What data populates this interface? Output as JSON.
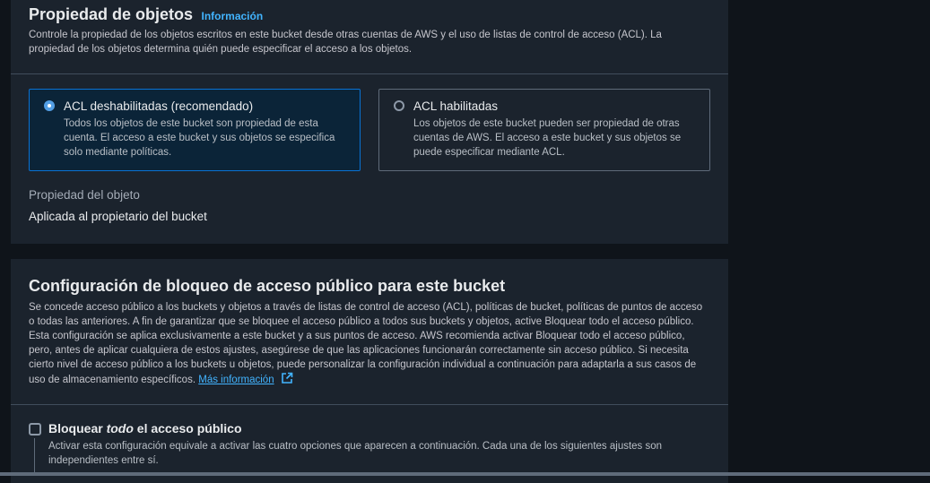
{
  "ownership": {
    "title": "Propiedad de objetos",
    "info_link": "Información",
    "description": "Controle la propiedad de los objetos escritos en este bucket desde otras cuentas de AWS y el uso de listas de control de acceso (ACL). La propiedad de los objetos determina quién puede especificar el acceso a los objetos.",
    "options": [
      {
        "label": "ACL deshabilitadas (recomendado)",
        "description": "Todos los objetos de este bucket son propiedad de esta cuenta. El acceso a este bucket y sus objetos se especifica solo mediante políticas.",
        "selected": true
      },
      {
        "label": "ACL habilitadas",
        "description": "Los objetos de este bucket pueden ser propiedad de otras cuentas de AWS. El acceso a este bucket y sus objetos se puede especificar mediante ACL.",
        "selected": false
      }
    ],
    "object_ownership_label": "Propiedad del objeto",
    "object_ownership_value": "Aplicada al propietario del bucket"
  },
  "block_public_access": {
    "title": "Configuración de bloqueo de acceso público para este bucket",
    "description": "Se concede acceso público a los buckets y objetos a través de listas de control de acceso (ACL), políticas de bucket, políticas de puntos de acceso o todas las anteriores. A fin de garantizar que se bloquee el acceso público a todos sus buckets y objetos, active Bloquear todo el acceso público. Esta configuración se aplica exclusivamente a este bucket y a sus puntos de acceso. AWS recomienda activar Bloquear todo el acceso público, pero, antes de aplicar cualquiera de estos ajustes, asegúrese de que las aplicaciones funcionarán correctamente sin acceso público. Si necesita cierto nivel de acceso público a los buckets u objetos, puede personalizar la configuración individual a continuación para adaptarla a sus casos de uso de almacenamiento específicos.",
    "more_info_link": "Más información",
    "block_all": {
      "label_prefix": "Bloquear ",
      "label_emphasis": "todo",
      "label_suffix": " el acceso público",
      "checked": false,
      "description": "Activar esta configuración equivale a activar las cuatro opciones que aparecen a continuación. Cada una de los siguientes ajustes son independientes entre sí."
    }
  },
  "colors": {
    "page_bg": "#0f141a",
    "panel_bg": "#1b232d",
    "accent": "#42b4ff",
    "selected_border": "#0972d3"
  }
}
